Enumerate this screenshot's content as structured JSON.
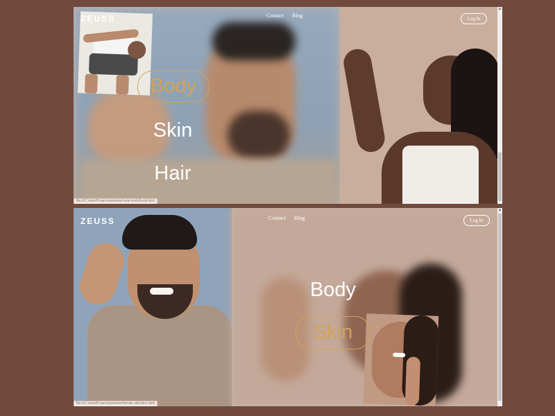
{
  "screens": [
    {
      "logo": "ZEUSS",
      "nav": [
        "Contact",
        "Blog"
      ],
      "login_label": "Log In",
      "menu": [
        "Body",
        "Skin",
        "Hair"
      ],
      "active_item": "Body",
      "status_url": "file:///C:/web/Projects/website/male-body/body.html"
    },
    {
      "logo": "ZEUSS",
      "nav": [
        "Contact",
        "Blog"
      ],
      "login_label": "Log In",
      "menu": [
        "Body",
        "Skin"
      ],
      "active_item": "Skin",
      "status_url": "file:///C:/web/Projects/website/female-skin/skin.html"
    }
  ],
  "colors": {
    "outer_background": "#6f4a3d",
    "active_menu": "#d2a35a",
    "left_photo_bg": "#8fa3b8",
    "right_photo_bg": "#c5ab9b"
  }
}
